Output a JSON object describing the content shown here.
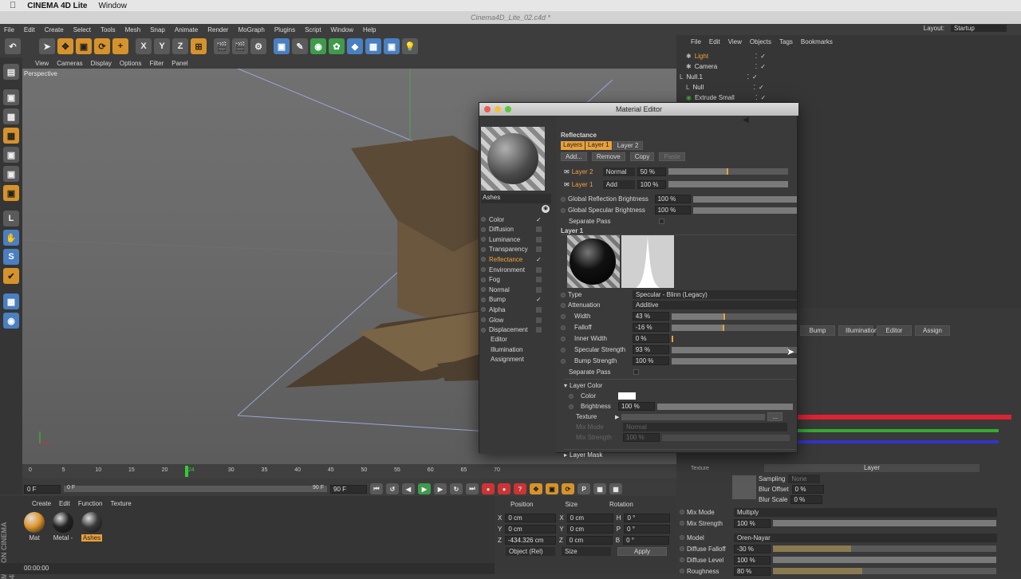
{
  "mac_menu": {
    "apple": "",
    "app": "CINEMA 4D Lite",
    "window": "Window"
  },
  "window_title": "Cinema4D_Lite_02.c4d *",
  "menubar": [
    "File",
    "Edit",
    "Create",
    "Select",
    "Tools",
    "Mesh",
    "Snap",
    "Animate",
    "Render",
    "MoGraph",
    "Plugins",
    "Script",
    "Window",
    "Help"
  ],
  "layout": {
    "label": "Layout:",
    "value": "Startup"
  },
  "viewport": {
    "menu": [
      "View",
      "Cameras",
      "Display",
      "Options",
      "Filter",
      "Panel"
    ],
    "label": "Perspective"
  },
  "object_manager": {
    "menu": [
      "File",
      "Edit",
      "View",
      "Objects",
      "Tags",
      "Bookmarks"
    ],
    "objects": [
      {
        "name": "Light",
        "selected": true
      },
      {
        "name": "Camera"
      },
      {
        "name": "Null.1"
      },
      {
        "name": "Null"
      },
      {
        "name": "Extrude Small"
      }
    ]
  },
  "attribute_tabs": [
    "Bump",
    "Illumination",
    "Editor",
    "Assign"
  ],
  "attr_lower": {
    "layer_label": "Layer",
    "texture_label": "Texture",
    "sampling": {
      "label": "Sampling",
      "value": "None"
    },
    "blur_offset": {
      "label": "Blur Offset",
      "value": "0 %"
    },
    "blur_scale": {
      "label": "Blur Scale",
      "value": "0 %"
    },
    "mix_mode": {
      "label": "Mix Mode",
      "value": "Multiply"
    },
    "mix_strength": {
      "label": "Mix Strength",
      "value": "100 %"
    },
    "model": {
      "label": "Model",
      "value": "Oren-Nayar"
    },
    "diffuse_falloff": {
      "label": "Diffuse Falloff",
      "value": "-30 %",
      "level": 0.35
    },
    "diffuse_level": {
      "label": "Diffuse Level",
      "value": "100 %",
      "level": 1.0
    },
    "roughness": {
      "label": "Roughness",
      "value": "80 %",
      "level": 0.4
    }
  },
  "timeline": {
    "ticks": [
      "0",
      "5",
      "10",
      "15",
      "20",
      "24",
      "30",
      "35",
      "40",
      "45",
      "50",
      "55",
      "60",
      "65",
      "70"
    ],
    "current": "24",
    "start_field": "0 F",
    "start_field2": "0 F",
    "end_field": "90 F",
    "end_field2": "90 F"
  },
  "material_manager": {
    "menu": [
      "Create",
      "Edit",
      "Function",
      "Texture"
    ],
    "materials": [
      {
        "name": "Mat",
        "color": "#e0962c"
      },
      {
        "name": "Metal -",
        "color": "#222222"
      },
      {
        "name": "Ashes",
        "color": "#3a3a3a",
        "selected": true
      }
    ]
  },
  "coordinates": {
    "headers": [
      "Position",
      "Size",
      "Rotation"
    ],
    "rows": [
      {
        "axis": "X",
        "pos": "0 cm",
        "size_axis": "X",
        "size": "0 cm",
        "rot_axis": "H",
        "rot": "0 °"
      },
      {
        "axis": "Y",
        "pos": "0 cm",
        "size_axis": "Y",
        "size": "0 cm",
        "rot_axis": "P",
        "rot": "0 °"
      },
      {
        "axis": "Z",
        "pos": "-434.326 cm",
        "size_axis": "Z",
        "size": "0 cm",
        "rot_axis": "B",
        "rot": "0 °"
      }
    ],
    "mode1": "Object (Rel)",
    "mode2": "Size",
    "apply": "Apply"
  },
  "status": "00:00:00",
  "material_editor": {
    "title": "Material Editor",
    "material_name": "Ashes",
    "channels": [
      {
        "name": "Color",
        "checked": true
      },
      {
        "name": "Diffusion",
        "checked": false
      },
      {
        "name": "Luminance",
        "checked": false
      },
      {
        "name": "Transparency",
        "checked": false
      },
      {
        "name": "Reflectance",
        "checked": true,
        "active": true
      },
      {
        "name": "Environment",
        "checked": false
      },
      {
        "name": "Fog",
        "checked": false
      },
      {
        "name": "Normal",
        "checked": false
      },
      {
        "name": "Bump",
        "checked": true
      },
      {
        "name": "Alpha",
        "checked": false
      },
      {
        "name": "Glow",
        "checked": false
      },
      {
        "name": "Displacement",
        "checked": false
      }
    ],
    "extras": [
      "Editor",
      "Illumination",
      "Assignment"
    ],
    "section": "Reflectance",
    "layer_tabs": [
      "Layers",
      "Layer 1",
      "Layer 2"
    ],
    "layer_buttons": [
      "Add...",
      "Remove",
      "Copy",
      "Paste"
    ],
    "layers": [
      {
        "name": "Layer 2",
        "mode": "Normal",
        "value": "50 %",
        "level": 0.5
      },
      {
        "name": "Layer 1",
        "mode": "Add",
        "value": "100 %",
        "level": 1.0
      }
    ],
    "global_reflection": {
      "label": "Global Reflection Brightness",
      "value": "100 %"
    },
    "global_specular": {
      "label": "Global Specular Brightness",
      "value": "100 %"
    },
    "separate_pass": "Separate Pass",
    "layer1_title": "Layer 1",
    "type": {
      "label": "Type",
      "value": "Specular - Blinn (Legacy)"
    },
    "attenuation": {
      "label": "Attenuation",
      "value": "Additive"
    },
    "width": {
      "label": "Width",
      "value": "43 %",
      "level": 0.43
    },
    "falloff": {
      "label": "Falloff",
      "value": "-16 %",
      "level": 0.42
    },
    "inner_width": {
      "label": "Inner Width",
      "value": "0 %",
      "level": 0.0
    },
    "specular_strength": {
      "label": "Specular Strength",
      "value": "93 %",
      "level": 0.93
    },
    "bump_strength": {
      "label": "Bump Strength",
      "value": "100 %",
      "level": 1.0
    },
    "separate_pass2": "Separate Pass",
    "layer_color": {
      "title": "Layer Color",
      "color_label": "Color",
      "brightness": {
        "label": "Brightness",
        "value": "100 %"
      },
      "texture_label": "Texture",
      "mix_mode": {
        "label": "Mix Mode",
        "value": "Normal"
      },
      "mix_strength": {
        "label": "Mix Strength",
        "value": "100 %"
      }
    },
    "layer_mask": "Layer Mask"
  }
}
